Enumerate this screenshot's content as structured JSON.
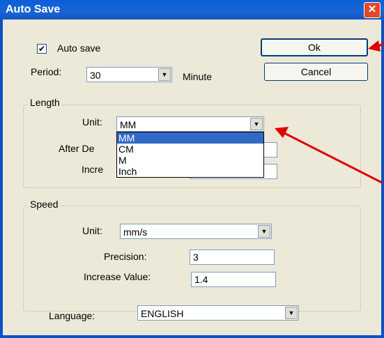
{
  "window": {
    "title": "Auto Save",
    "close_glyph": "✕"
  },
  "auto_save": {
    "label": "Auto save",
    "checked": true,
    "check_glyph": "✔"
  },
  "period": {
    "label": "Period:",
    "value": "30",
    "unit": "Minute"
  },
  "buttons": {
    "ok": "Ok",
    "cancel": "Cancel"
  },
  "length": {
    "group_label": "Length",
    "unit_label": "Unit:",
    "unit_value": "MM",
    "dropdown_options": [
      "MM",
      "CM",
      "M",
      "Inch"
    ],
    "after_label_partial": "After De",
    "increase_label_partial": "Incre"
  },
  "speed": {
    "group_label": "Speed",
    "unit_label": "Unit:",
    "unit_value": "mm/s",
    "precision_label": "Precision:",
    "precision_value": "3",
    "increase_label": "Increase Value:",
    "increase_value": "1.4"
  },
  "language": {
    "label": "Language:",
    "value": "ENGLISH"
  },
  "icons": {
    "dropdown_glyph": "▼"
  },
  "colors": {
    "annotation_arrow": "#e00000",
    "selection": "#316ac5",
    "title_bar": "#1b64d6"
  }
}
